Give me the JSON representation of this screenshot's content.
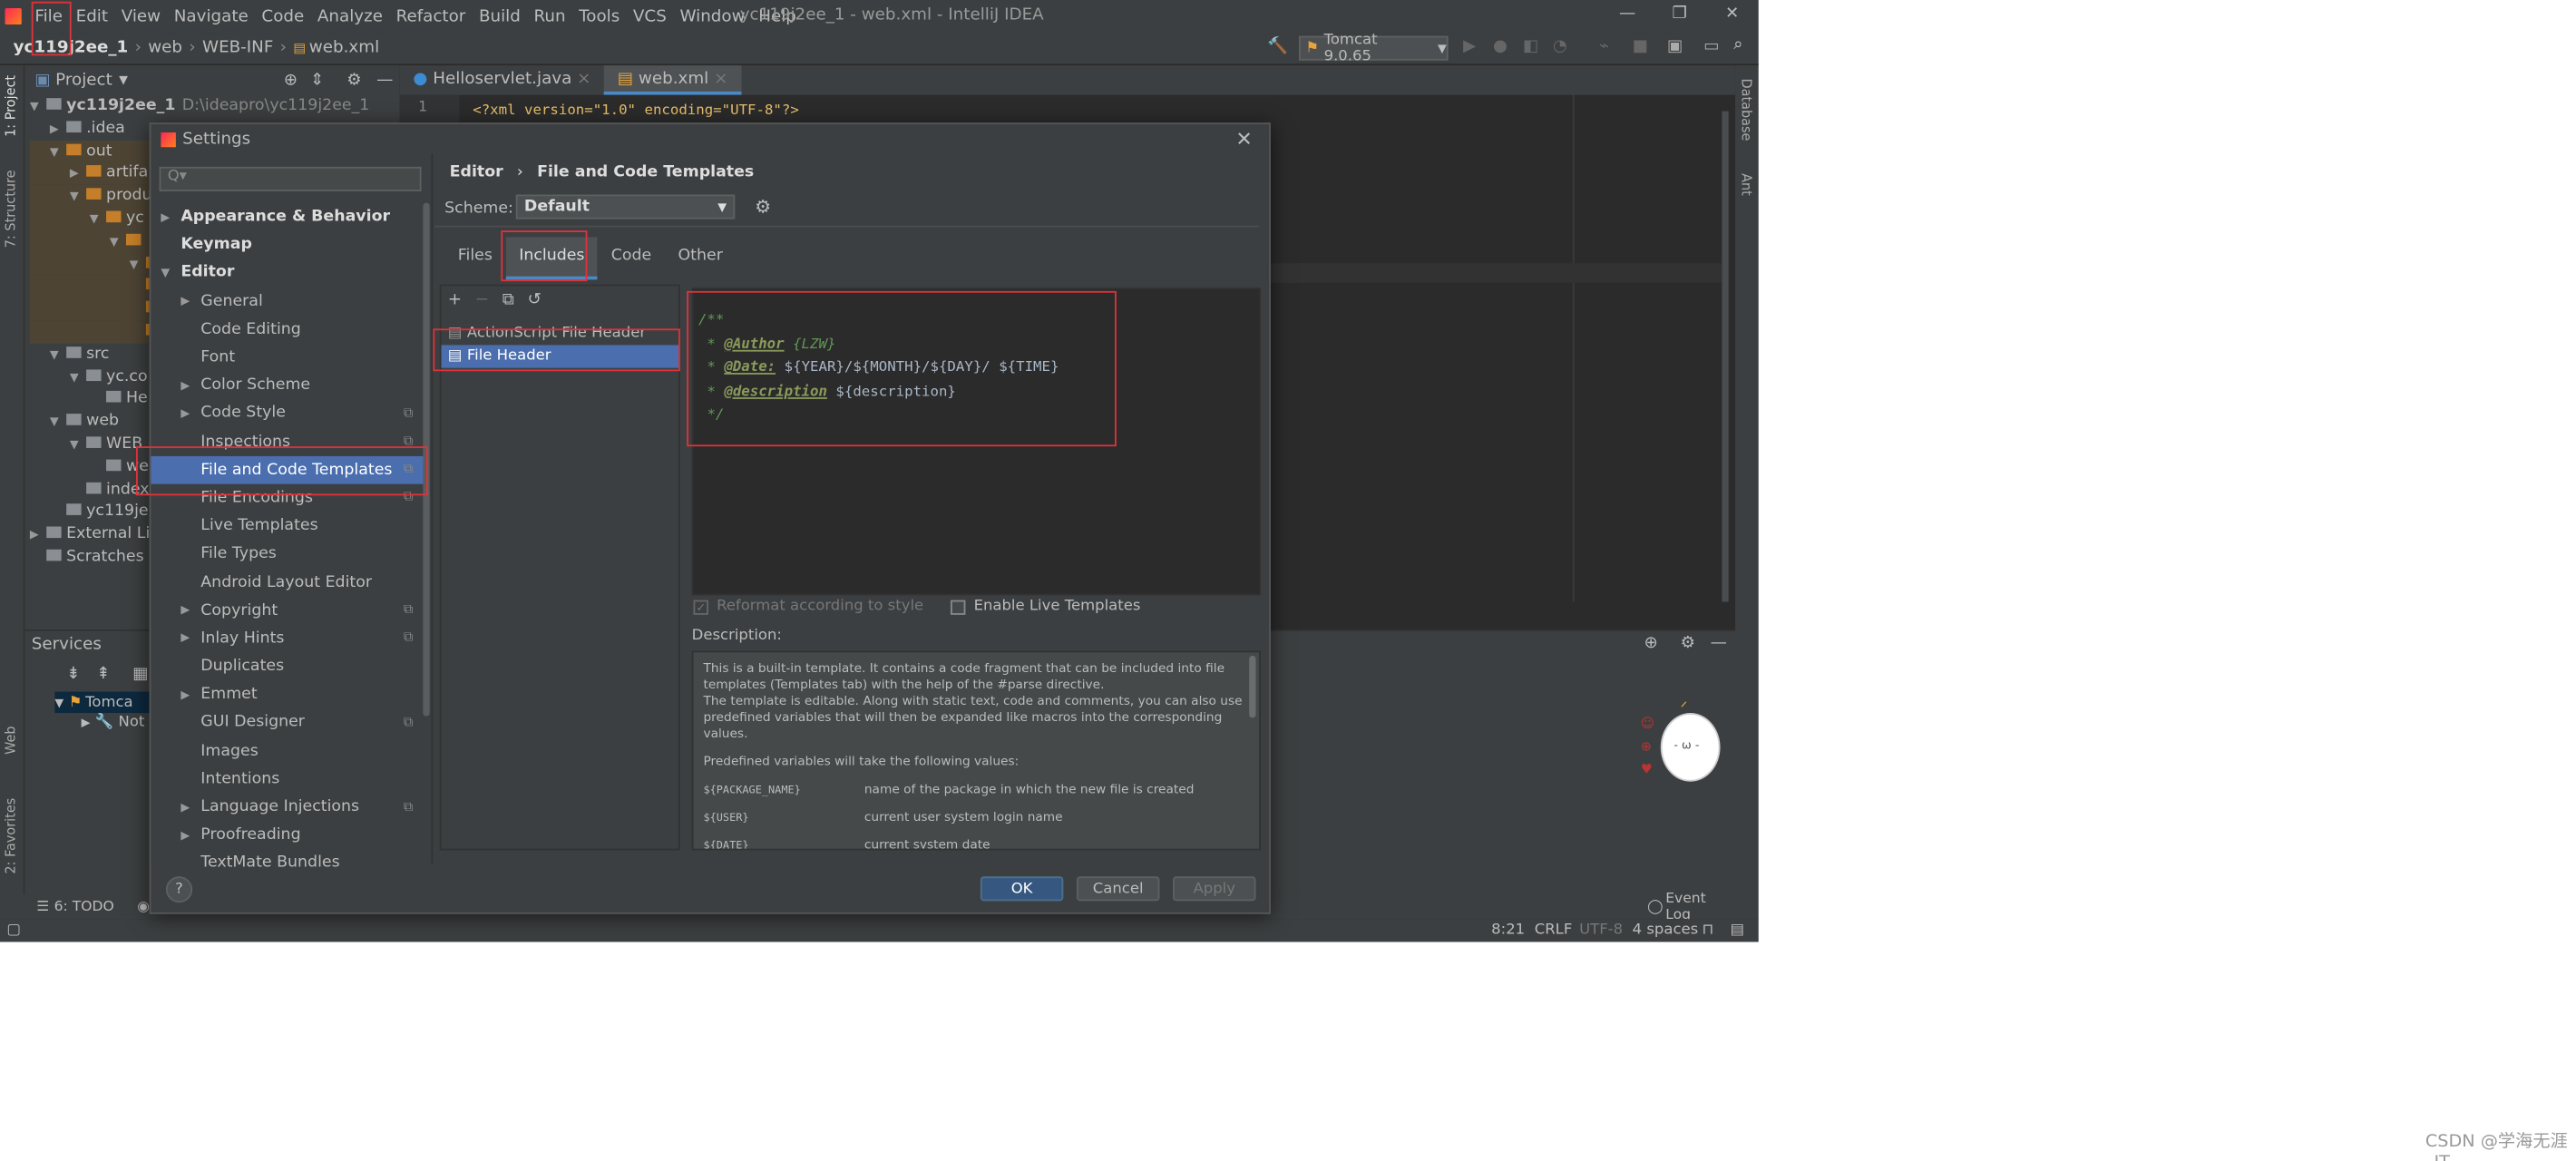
{
  "menubar": {
    "items": [
      "File",
      "Edit",
      "View",
      "Navigate",
      "Code",
      "Analyze",
      "Refactor",
      "Build",
      "Run",
      "Tools",
      "VCS",
      "Window",
      "Help"
    ],
    "title": "yc119j2ee_1 - web.xml - IntelliJ IDEA"
  },
  "navbar": {
    "crumbs": [
      "yc119j2ee_1",
      "web",
      "WEB-INF",
      "web.xml"
    ],
    "run_config": "Tomcat 9.0.65"
  },
  "project": {
    "header": "Project",
    "tree": [
      {
        "t": "yc119j2ee_1",
        "extra": "D:\\ideapro\\yc119j2ee_1",
        "l": 0,
        "ar": "▼"
      },
      {
        "t": ".idea",
        "l": 1,
        "ar": "▶"
      },
      {
        "t": "out",
        "l": 1,
        "ar": "▼"
      },
      {
        "t": "artifa",
        "l": 2,
        "ar": "▶"
      },
      {
        "t": "produ",
        "l": 2,
        "ar": "▼"
      },
      {
        "t": "yc",
        "l": 3,
        "ar": "▼"
      },
      {
        "t": "",
        "l": 4,
        "ar": "▼"
      },
      {
        "t": "",
        "l": 5,
        "ar": "▼"
      },
      {
        "t": "",
        "l": 5,
        "ar": ""
      },
      {
        "t": "",
        "l": 5,
        "ar": ""
      },
      {
        "t": "",
        "l": 5,
        "ar": ""
      },
      {
        "t": "src",
        "l": 1,
        "ar": "▼"
      },
      {
        "t": "yc.co",
        "l": 2,
        "ar": "▼"
      },
      {
        "t": "He",
        "l": 3,
        "ar": ""
      },
      {
        "t": "web",
        "l": 1,
        "ar": "▼"
      },
      {
        "t": "WEB",
        "l": 2,
        "ar": "▼"
      },
      {
        "t": "we",
        "l": 3,
        "ar": ""
      },
      {
        "t": "index",
        "l": 2,
        "ar": ""
      },
      {
        "t": "yc119je",
        "l": 1,
        "ar": ""
      },
      {
        "t": "External Lib",
        "l": 0,
        "ar": "▶"
      },
      {
        "t": "Scratches a",
        "l": 0,
        "ar": ""
      }
    ]
  },
  "editor": {
    "tabs": [
      "Helloservlet.java",
      "web.xml"
    ],
    "line_no": "1",
    "line": "<?xml version=\"1.0\" encoding=\"UTF-8\"?>"
  },
  "services": {
    "title": "Services",
    "items": [
      "Tomca",
      "Not"
    ]
  },
  "bottombar": {
    "todo": "6: TODO",
    "event_log": "Event Log"
  },
  "statusbar": {
    "pos": "8:21",
    "crlf": "CRLF",
    "enc": "UTF-8",
    "indent": "4 spaces"
  },
  "left_strip": [
    "1: Project",
    "7: Structure",
    "Web",
    "2: Favorites"
  ],
  "right_strip": [
    "Database",
    "Ant"
  ],
  "dialog": {
    "title": "Settings",
    "search_placeholder": "Q▾",
    "breadcrumb": [
      "Editor",
      "File and Code Templates"
    ],
    "scheme_label": "Scheme:",
    "scheme_value": "Default",
    "tabs": [
      "Files",
      "Includes",
      "Code",
      "Other"
    ],
    "sidebar": [
      {
        "t": "Appearance & Behavior",
        "l": 0,
        "ar": "▶",
        "b": true
      },
      {
        "t": "Keymap",
        "l": 0,
        "b": true
      },
      {
        "t": "Editor",
        "l": 0,
        "ar": "▼",
        "b": true
      },
      {
        "t": "General",
        "l": 1,
        "ar": "▶"
      },
      {
        "t": "Code Editing",
        "l": 1
      },
      {
        "t": "Font",
        "l": 1
      },
      {
        "t": "Color Scheme",
        "l": 1,
        "ar": "▶"
      },
      {
        "t": "Code Style",
        "l": 1,
        "ar": "▶",
        "cp": true
      },
      {
        "t": "Inspections",
        "l": 1,
        "cp": true
      },
      {
        "t": "File and Code Templates",
        "l": 1,
        "cp": true,
        "sel": true
      },
      {
        "t": "File Encodings",
        "l": 1,
        "cp": true
      },
      {
        "t": "Live Templates",
        "l": 1
      },
      {
        "t": "File Types",
        "l": 1
      },
      {
        "t": "Android Layout Editor",
        "l": 1
      },
      {
        "t": "Copyright",
        "l": 1,
        "ar": "▶",
        "cp": true
      },
      {
        "t": "Inlay Hints",
        "l": 1,
        "ar": "▶",
        "cp": true
      },
      {
        "t": "Duplicates",
        "l": 1
      },
      {
        "t": "Emmet",
        "l": 1,
        "ar": "▶"
      },
      {
        "t": "GUI Designer",
        "l": 1,
        "cp": true
      },
      {
        "t": "Images",
        "l": 1
      },
      {
        "t": "Intentions",
        "l": 1
      },
      {
        "t": "Language Injections",
        "l": 1,
        "ar": "▶",
        "cp": true
      },
      {
        "t": "Proofreading",
        "l": 1,
        "ar": "▶"
      },
      {
        "t": "TextMate Bundles",
        "l": 1
      }
    ],
    "templates": [
      "ActionScript File Header",
      "File Header"
    ],
    "code": {
      "l1": "/**",
      "author_tag": "@Author",
      "author_val": "{LZW}",
      "date_tag": "@Date:",
      "date_val": "${YEAR}/${MONTH}/${DAY}/ ${TIME}",
      "desc_tag": "@description",
      "desc_val": "${description}",
      "end": "*/"
    },
    "reformat": "Reformat according to style",
    "live_templates": "Enable Live Templates",
    "description_label": "Description:",
    "description_text": [
      "This is a built-in template. It contains a code fragment that can be included into file",
      "templates (Templates tab) with the help of the #parse directive.",
      "The template is editable. Along with static text, code and comments, you can also use",
      "predefined variables that will then be expanded like macros into the corresponding values."
    ],
    "predef": "Predefined variables will take the following values:",
    "vars": [
      {
        "k": "${PACKAGE_NAME}",
        "v": "name of the package in which the new file is created"
      },
      {
        "k": "${USER}",
        "v": "current user system login name"
      },
      {
        "k": "${DATE}",
        "v": "current system date"
      }
    ],
    "buttons": {
      "ok": "OK",
      "cancel": "Cancel",
      "apply": "Apply",
      "help": "?"
    }
  },
  "watermark": "CSDN @学海无涯_IT"
}
